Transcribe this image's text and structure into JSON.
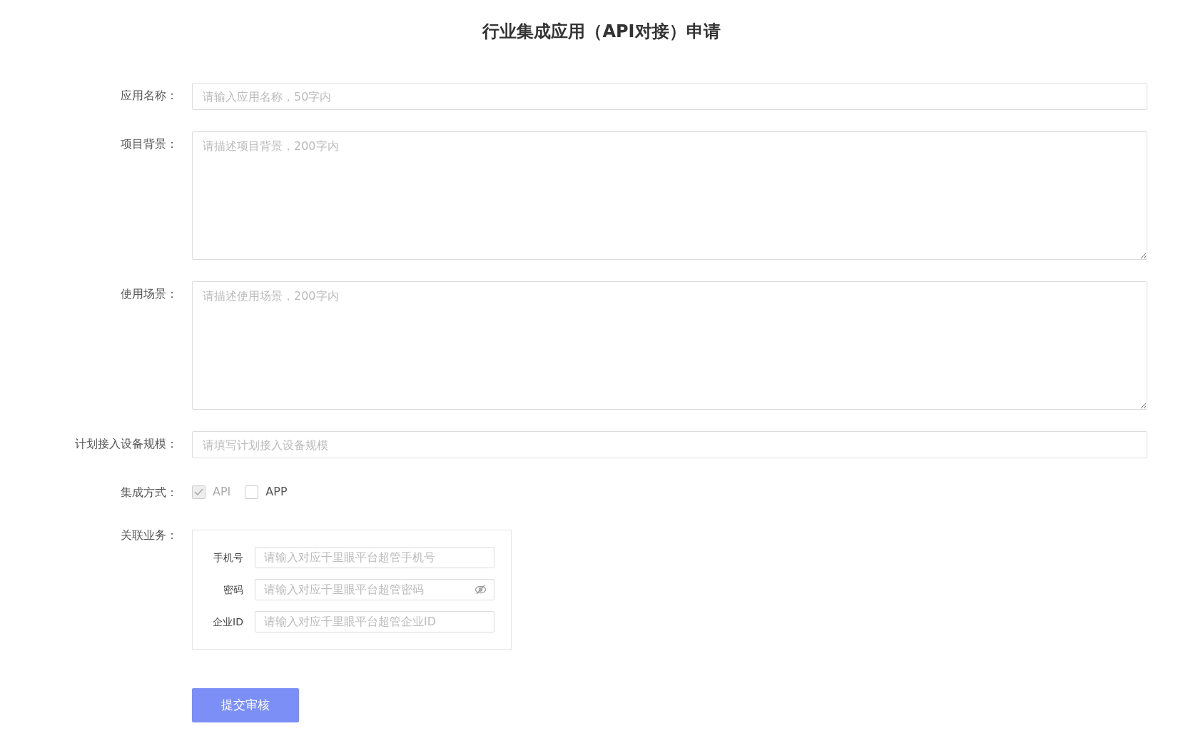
{
  "title": "行业集成应用（API对接）申请",
  "fields": [
    {
      "kind": "input",
      "label": "应用名称：",
      "placeholder": "请输入应用名称，50字内"
    },
    {
      "kind": "textarea",
      "label": "项目背景：",
      "placeholder": "请描述项目背景，200字内"
    },
    {
      "kind": "textarea",
      "label": "使用场景：",
      "placeholder": "请描述使用场景，200字内"
    },
    {
      "kind": "input",
      "label": "计划接入设备规模：",
      "placeholder": "请填写计划接入设备规模"
    },
    {
      "kind": "checks",
      "label": "集成方式：",
      "options": [
        {
          "label": "API",
          "checked": true,
          "disabled": true
        },
        {
          "label": "APP",
          "checked": false,
          "disabled": false
        }
      ]
    },
    {
      "kind": "group",
      "label": "关联业务：",
      "rows": [
        {
          "kind": "text",
          "label": "手机号",
          "placeholder": "请输入对应千里眼平台超管手机号"
        },
        {
          "kind": "password",
          "label": "密码",
          "placeholder": "请输入对应千里眼平台超管密码"
        },
        {
          "kind": "text",
          "label": "企业ID",
          "placeholder": "请输入对应千里眼平台超管企业ID"
        }
      ]
    }
  ],
  "submit": "提交审核"
}
